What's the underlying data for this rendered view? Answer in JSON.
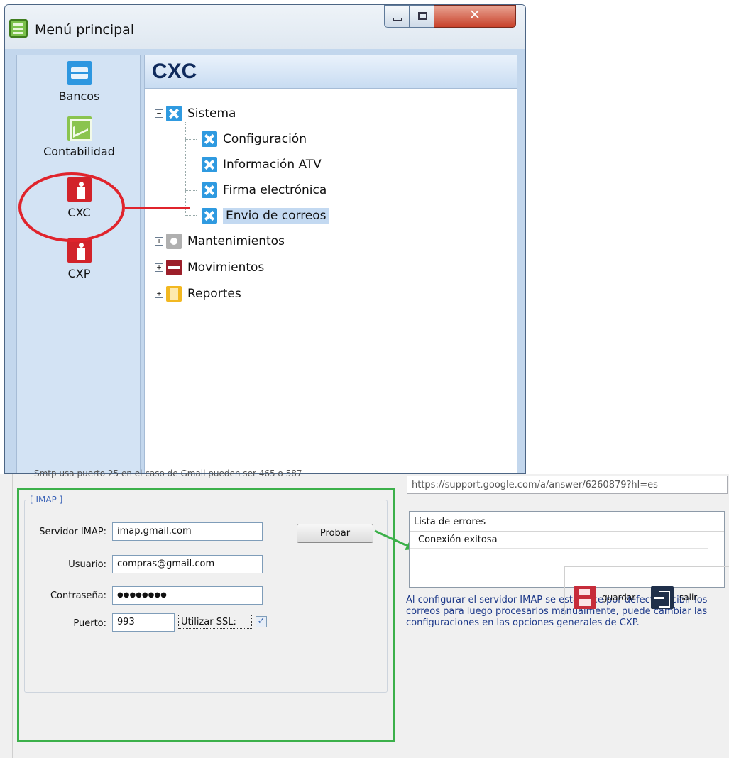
{
  "window": {
    "title": "Menú principal"
  },
  "sidebar": {
    "items": [
      {
        "label": "Bancos",
        "icon": "briefcase-icon"
      },
      {
        "label": "Contabilidad",
        "icon": "chart-icon"
      },
      {
        "label": "CXC",
        "icon": "person-icon"
      },
      {
        "label": "CXP",
        "icon": "person-money-icon"
      }
    ]
  },
  "panel": {
    "title": "CXC",
    "tree": {
      "root": "Sistema",
      "children": [
        "Configuración",
        "Información ATV",
        "Firma electrónica",
        "Envio de correos"
      ],
      "selected": "Envio de correos",
      "others": [
        "Mantenimientos",
        "Movimientos",
        "Reportes"
      ]
    }
  },
  "config": {
    "smtp_note": "Smtp usa puerto 25 en el caso de Gmail pueden ser 465 o 587",
    "help_url": "https://support.google.com/a/answer/6260879?hl=es",
    "imap": {
      "legend": "[ IMAP ]",
      "server_label": "Servidor IMAP:",
      "server_value": "imap.gmail.com",
      "user_label": "Usuario:",
      "user_value": "compras@gmail.com",
      "password_label": "Contraseña:",
      "password_value": "●●●●●●●●",
      "port_label": "Puerto:",
      "port_value": "993",
      "ssl_label": "Utilizar SSL:",
      "ssl_checked": "✓",
      "test_button": "Probar"
    },
    "errors": {
      "header": "Lista de errores",
      "rows": [
        "Conexión exitosa"
      ]
    },
    "info": "Al configurar el servidor IMAP se establece por defecto recibir los correos para luego procesarlos manualmente, puede cambiar las configuraciones en las opciones generales de CXP.",
    "actions": {
      "save": "guardar",
      "exit": "salir"
    }
  },
  "annotation_colors": {
    "highlight_red": "#e0242c",
    "highlight_green": "#3cb04a"
  }
}
